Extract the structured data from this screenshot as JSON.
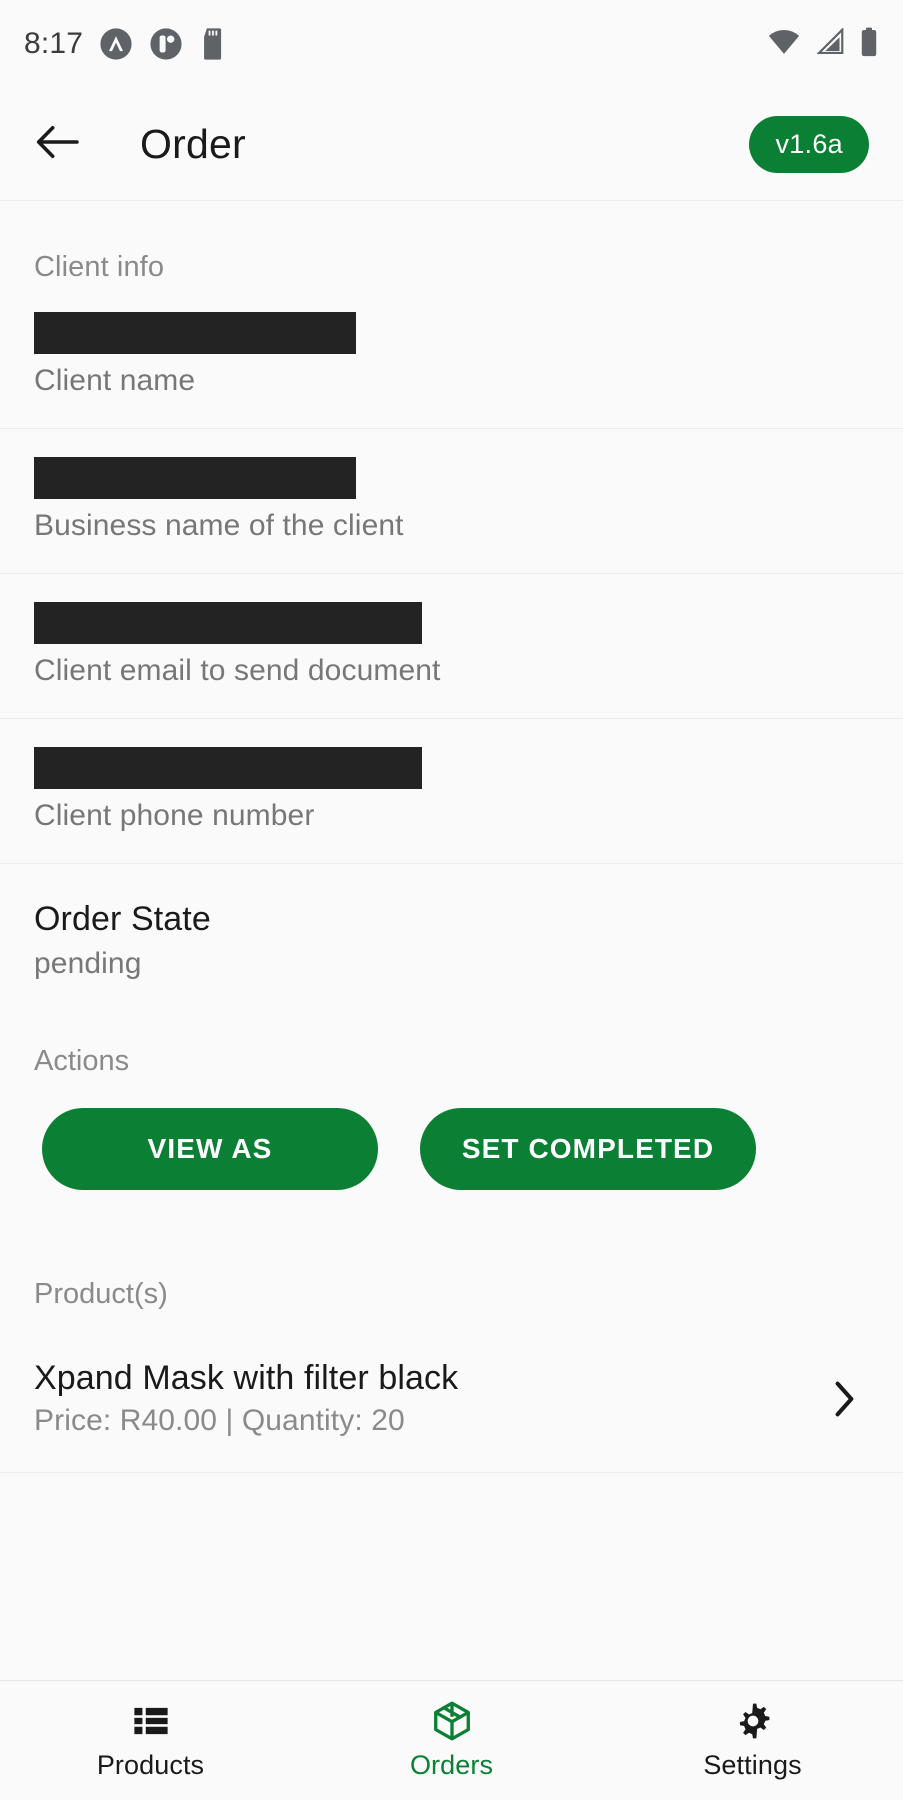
{
  "statusbar": {
    "time": "8:17",
    "left_icons": [
      "app-badge-icon",
      "app-partial-icon",
      "sd-card-icon"
    ],
    "right_icons": [
      "wifi-icon",
      "cellular-signal-icon",
      "battery-icon"
    ]
  },
  "appbar": {
    "back_icon": "arrow-left-icon",
    "title": "Order",
    "version_badge": "v1.6a"
  },
  "client_info": {
    "section_label": "Client info",
    "fields": [
      {
        "value": "",
        "redacted": true,
        "label": "Client name"
      },
      {
        "value": "",
        "redacted": true,
        "label": "Business name of the client"
      },
      {
        "value": "",
        "redacted": true,
        "label": "Client email to send document"
      },
      {
        "value": "",
        "redacted": true,
        "label": "Client phone number"
      }
    ]
  },
  "order_state": {
    "title": "Order State",
    "value": "pending"
  },
  "actions": {
    "label": "Actions",
    "view_as": "VIEW AS",
    "set_completed": "SET COMPLETED"
  },
  "products": {
    "label": "Product(s)",
    "items": [
      {
        "name": "Xpand Mask with filter black",
        "meta": "Price: R40.00 | Quantity: 20",
        "chevron_icon": "chevron-right-icon"
      }
    ]
  },
  "bottom_nav": {
    "items": [
      {
        "label": "Products",
        "icon": "list-view-icon",
        "active": false
      },
      {
        "label": "Orders",
        "icon": "box-cube-icon",
        "active": true
      },
      {
        "label": "Settings",
        "icon": "gear-icon",
        "active": false
      }
    ]
  },
  "colors": {
    "accent_green": "#0B8034",
    "background": "#FAFAFA",
    "text_primary": "#1A1A1A",
    "text_secondary": "#8A8A8A",
    "redaction": "#232323"
  }
}
